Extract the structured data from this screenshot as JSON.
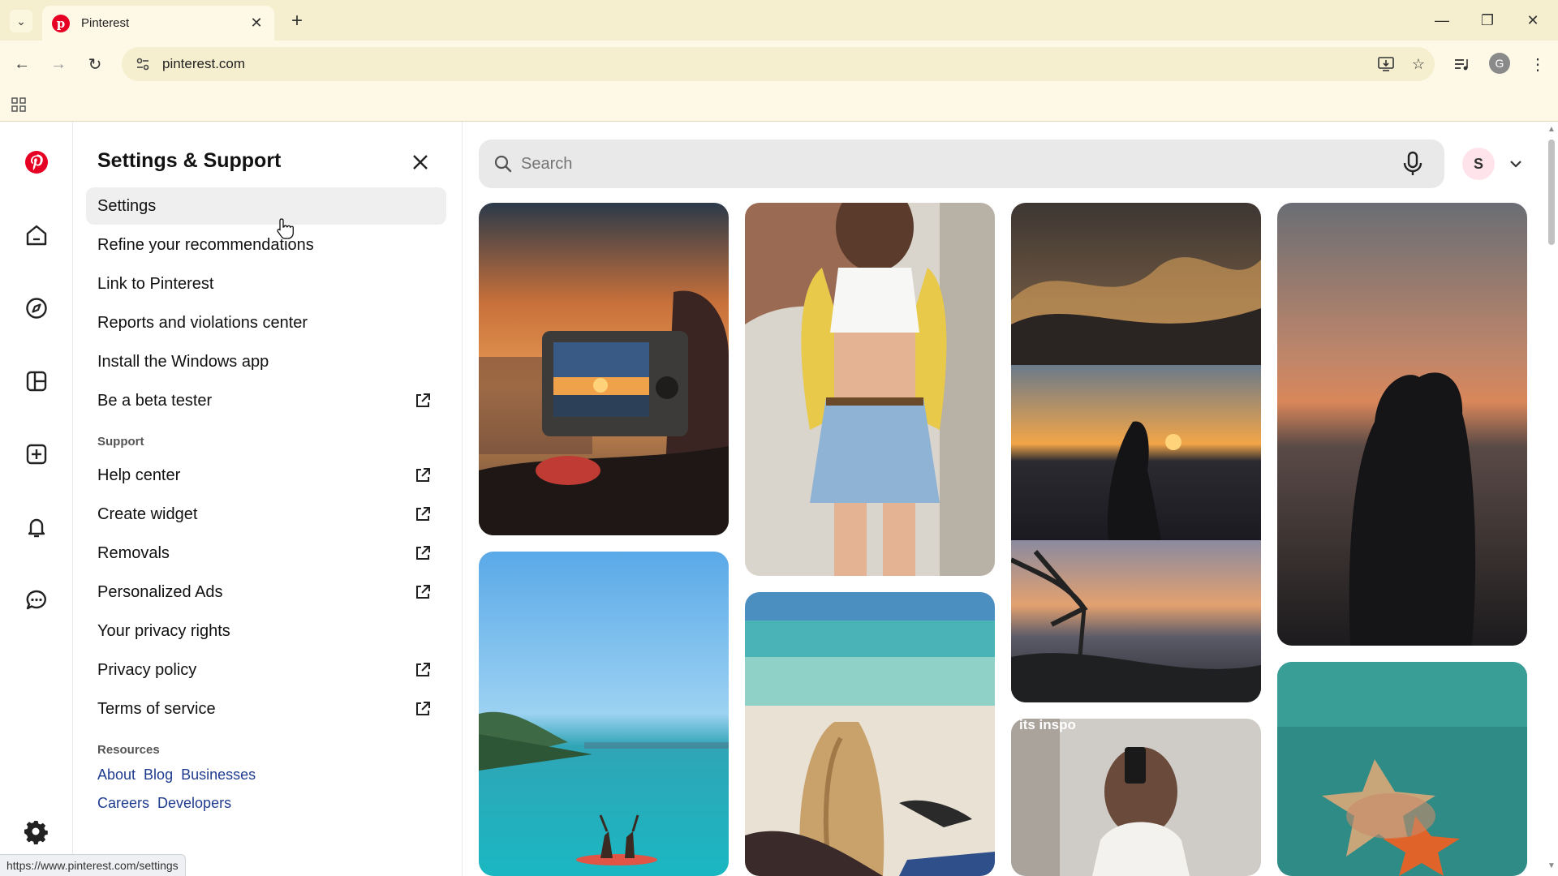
{
  "browser": {
    "tab_title": "Pinterest",
    "address": "pinterest.com",
    "profile_letter": "G"
  },
  "panel": {
    "title": "Settings & Support",
    "items": [
      {
        "label": "Settings",
        "external": false
      },
      {
        "label": "Refine your recommendations",
        "external": false
      },
      {
        "label": "Link to Pinterest",
        "external": false
      },
      {
        "label": "Reports and violations center",
        "external": false
      },
      {
        "label": "Install the Windows app",
        "external": false
      },
      {
        "label": "Be a beta tester",
        "external": true
      }
    ],
    "support_label": "Support",
    "support_items": [
      {
        "label": "Help center",
        "external": true
      },
      {
        "label": "Create widget",
        "external": true
      },
      {
        "label": "Removals",
        "external": true
      },
      {
        "label": "Personalized Ads",
        "external": true
      },
      {
        "label": "Your privacy rights",
        "external": false
      },
      {
        "label": "Privacy policy",
        "external": true
      },
      {
        "label": "Terms of service",
        "external": true
      }
    ],
    "resources_label": "Resources",
    "resources_row1": [
      "About",
      "Blog",
      "Businesses"
    ],
    "resources_row2": [
      "Careers",
      "Developers"
    ]
  },
  "search": {
    "placeholder": "Search"
  },
  "user": {
    "avatar_letter": "S"
  },
  "status_bar": {
    "url": "https://www.pinterest.com/settings"
  },
  "pin_overlay_text": "its inspo",
  "colors": {
    "brand": "#e60023",
    "chrome_bg": "#f5efcf",
    "link": "#1f3b8f"
  }
}
